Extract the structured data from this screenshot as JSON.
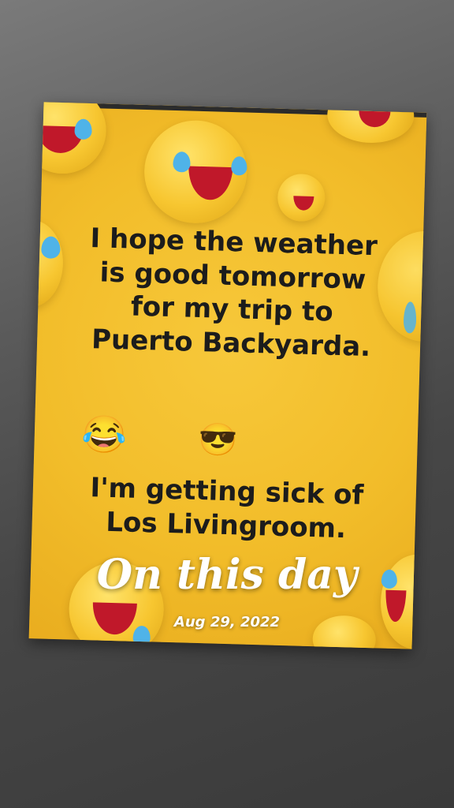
{
  "post": {
    "line1": "I hope the weather",
    "line2": "is good tomorrow",
    "line3": "for my trip to",
    "line4": "Puerto Backyarda.",
    "emoji_laugh": "😂",
    "emoji_cool": "😎",
    "line5": "I'm getting sick of",
    "line6": "Los Livingroom."
  },
  "memory": {
    "title": "On this day",
    "date": "Aug 29, 2022"
  },
  "colors": {
    "card_yellow": "#f2bd2a",
    "text_dark": "#1c1c1c",
    "overlay_text": "#ffffff"
  }
}
